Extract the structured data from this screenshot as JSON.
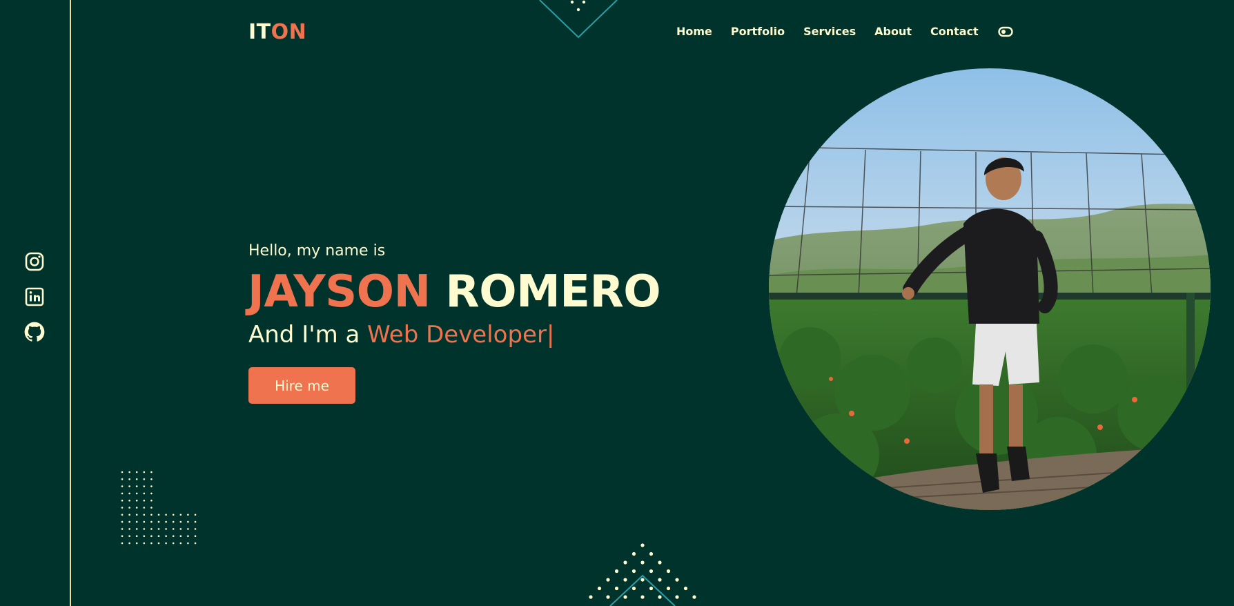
{
  "brand": {
    "logo_part1": "IT",
    "logo_part2": "ON"
  },
  "nav": {
    "items": [
      "Home",
      "Portfolio",
      "Services",
      "About",
      "Contact"
    ],
    "theme_toggle_icon": "toggle-icon"
  },
  "socials": {
    "icons": [
      "instagram-icon",
      "linkedin-icon",
      "github-icon"
    ]
  },
  "hero": {
    "greeting": "Hello, my name is",
    "first_name": "JAYSON",
    "last_name": "ROMERO",
    "role_prefix": "And I'm a",
    "role": "Web Developer",
    "cursor": "|",
    "cta": "Hire me"
  },
  "colors": {
    "background": "#00332b",
    "accent": "#f07350",
    "text": "#fffbd0",
    "line": "#f2d9a0",
    "teal": "#2a9fa8"
  }
}
